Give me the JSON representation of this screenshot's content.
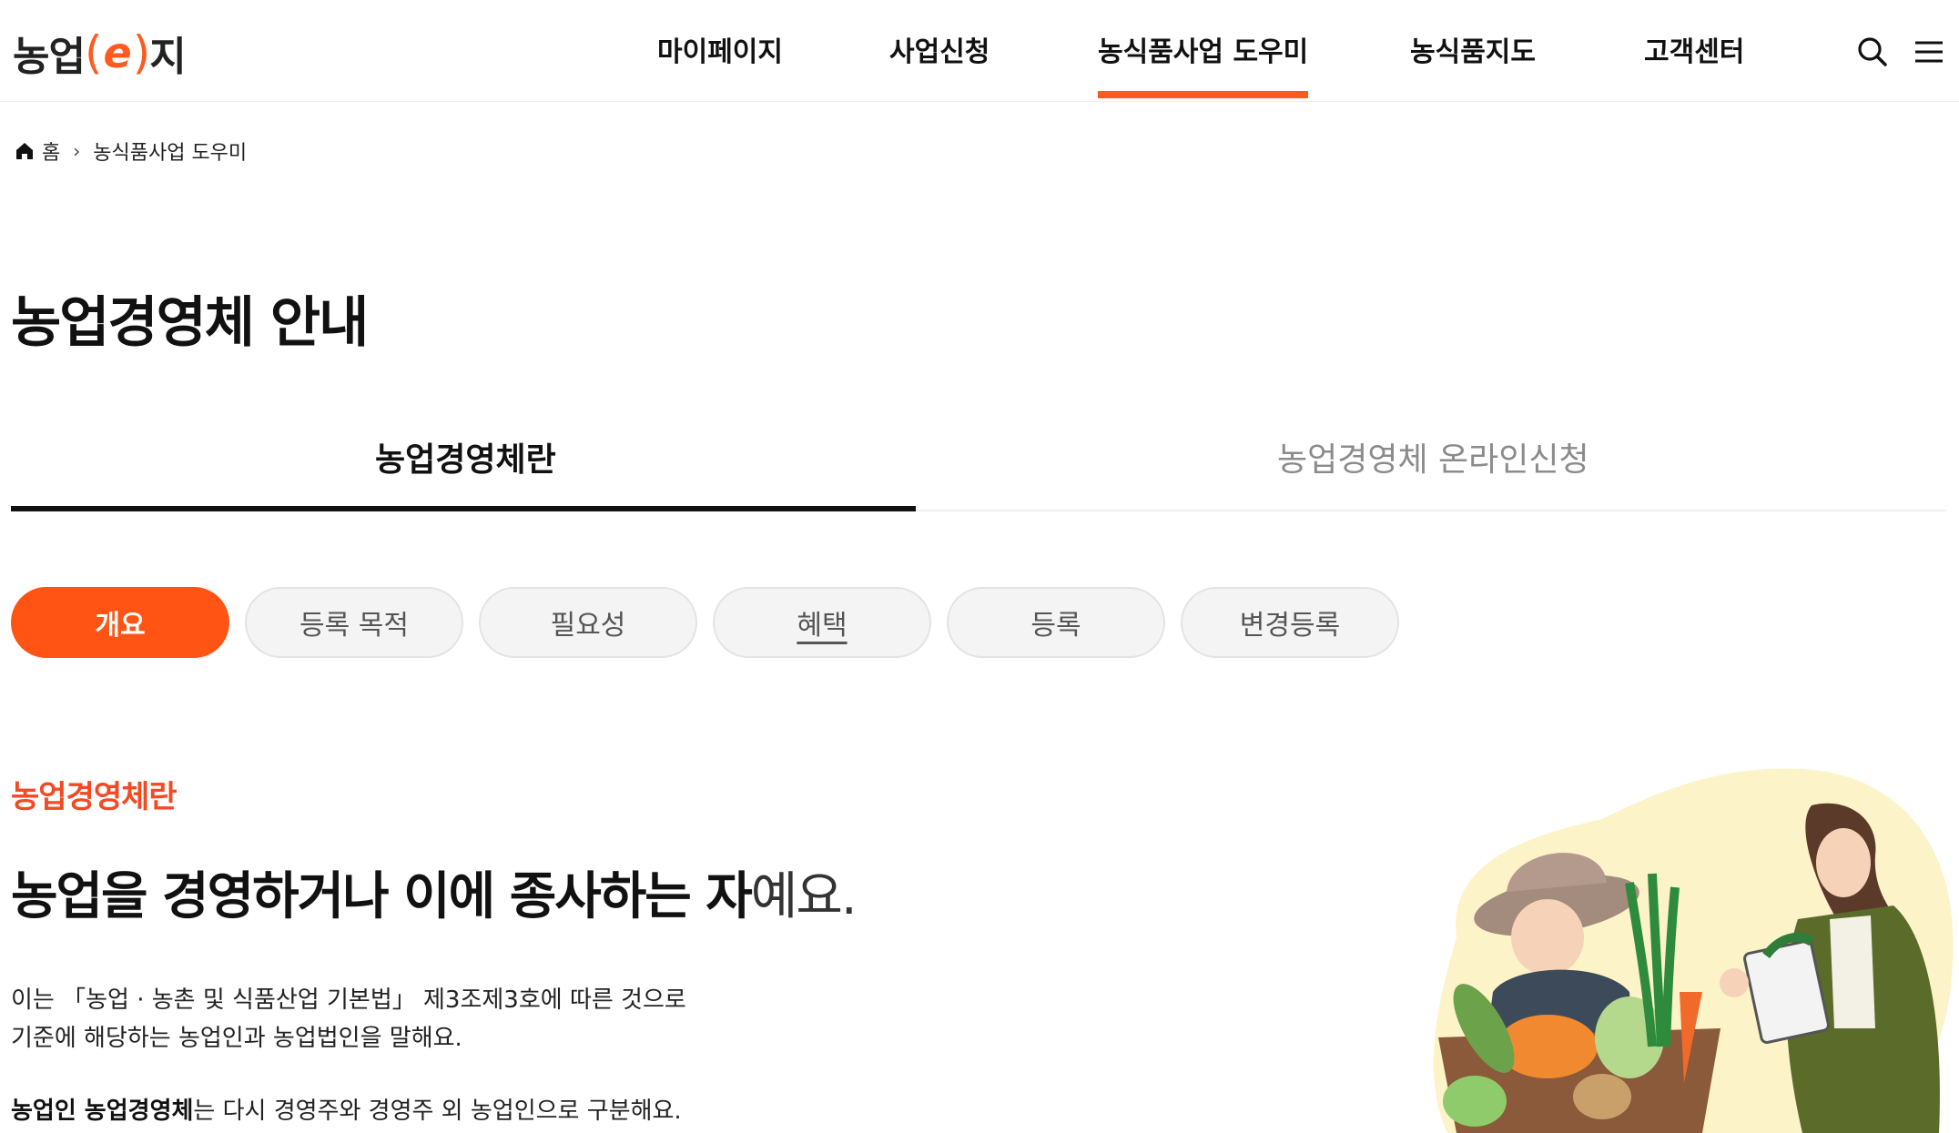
{
  "header": {
    "logo": {
      "part1": "농업",
      "open_paren": "(",
      "e": "e",
      "close_paren": ")",
      "part2": "지"
    },
    "nav": [
      {
        "label": "마이페이지"
      },
      {
        "label": "사업신청"
      },
      {
        "label": "농식품사업 도우미",
        "active": true
      },
      {
        "label": "농식품지도"
      },
      {
        "label": "고객센터"
      }
    ],
    "icons": [
      "search-icon",
      "menu-icon"
    ]
  },
  "breadcrumb": {
    "home": "홈",
    "current": "농식품사업 도우미"
  },
  "page_title": "농업경영체 안내",
  "tabs": [
    {
      "label": "농업경영체란",
      "active": true
    },
    {
      "label": "농업경영체 온라인신청",
      "active": false
    }
  ],
  "pills": [
    {
      "label": "개요",
      "active": true
    },
    {
      "label": "등록 목적"
    },
    {
      "label": "필요성"
    },
    {
      "label": "혜택"
    },
    {
      "label": "등록"
    },
    {
      "label": "변경등록"
    }
  ],
  "content": {
    "section_label": "농업경영체란",
    "headline_bold": "농업을 경영하거나 이에 종사하는 자",
    "headline_light": "예요.",
    "para1_line1": "이는 「농업 · 농촌 및 식품산업 기본법」 제3조제3호에 따른 것으로",
    "para1_line2": "기준에 해당하는 농업인과 농업법인을 말해요.",
    "para2_bold": "농업인 농업경영체",
    "para2_rest": "는 다시 경영주와 경영주 외 농업인으로 구분해요."
  },
  "colors": {
    "accent": "#ff5414",
    "section_label": "#f24a24"
  }
}
